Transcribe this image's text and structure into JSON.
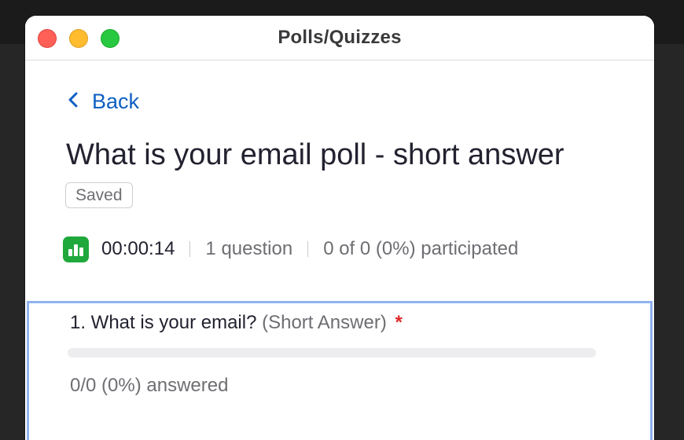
{
  "window": {
    "title": "Polls/Quizzes"
  },
  "nav": {
    "back_label": "Back"
  },
  "poll": {
    "title": "What is your email poll - short answer",
    "status_badge": "Saved",
    "timer": "00:00:14",
    "question_count": "1 question",
    "participation": "0 of 0 (0%) participated"
  },
  "questions": [
    {
      "text": "1. What is your email?",
      "type": "(Short Answer)",
      "required_marker": "*",
      "answered_fraction": 0,
      "answered_text": "0/0 (0%) answered"
    }
  ],
  "colors": {
    "accent": "#0e5fc2",
    "poll_icon": "#1fa83c",
    "required": "#e02828",
    "selected_border": "#8fb2ef"
  },
  "icons": {
    "back": "chevron-left-icon",
    "poll": "bar-chart-icon"
  }
}
